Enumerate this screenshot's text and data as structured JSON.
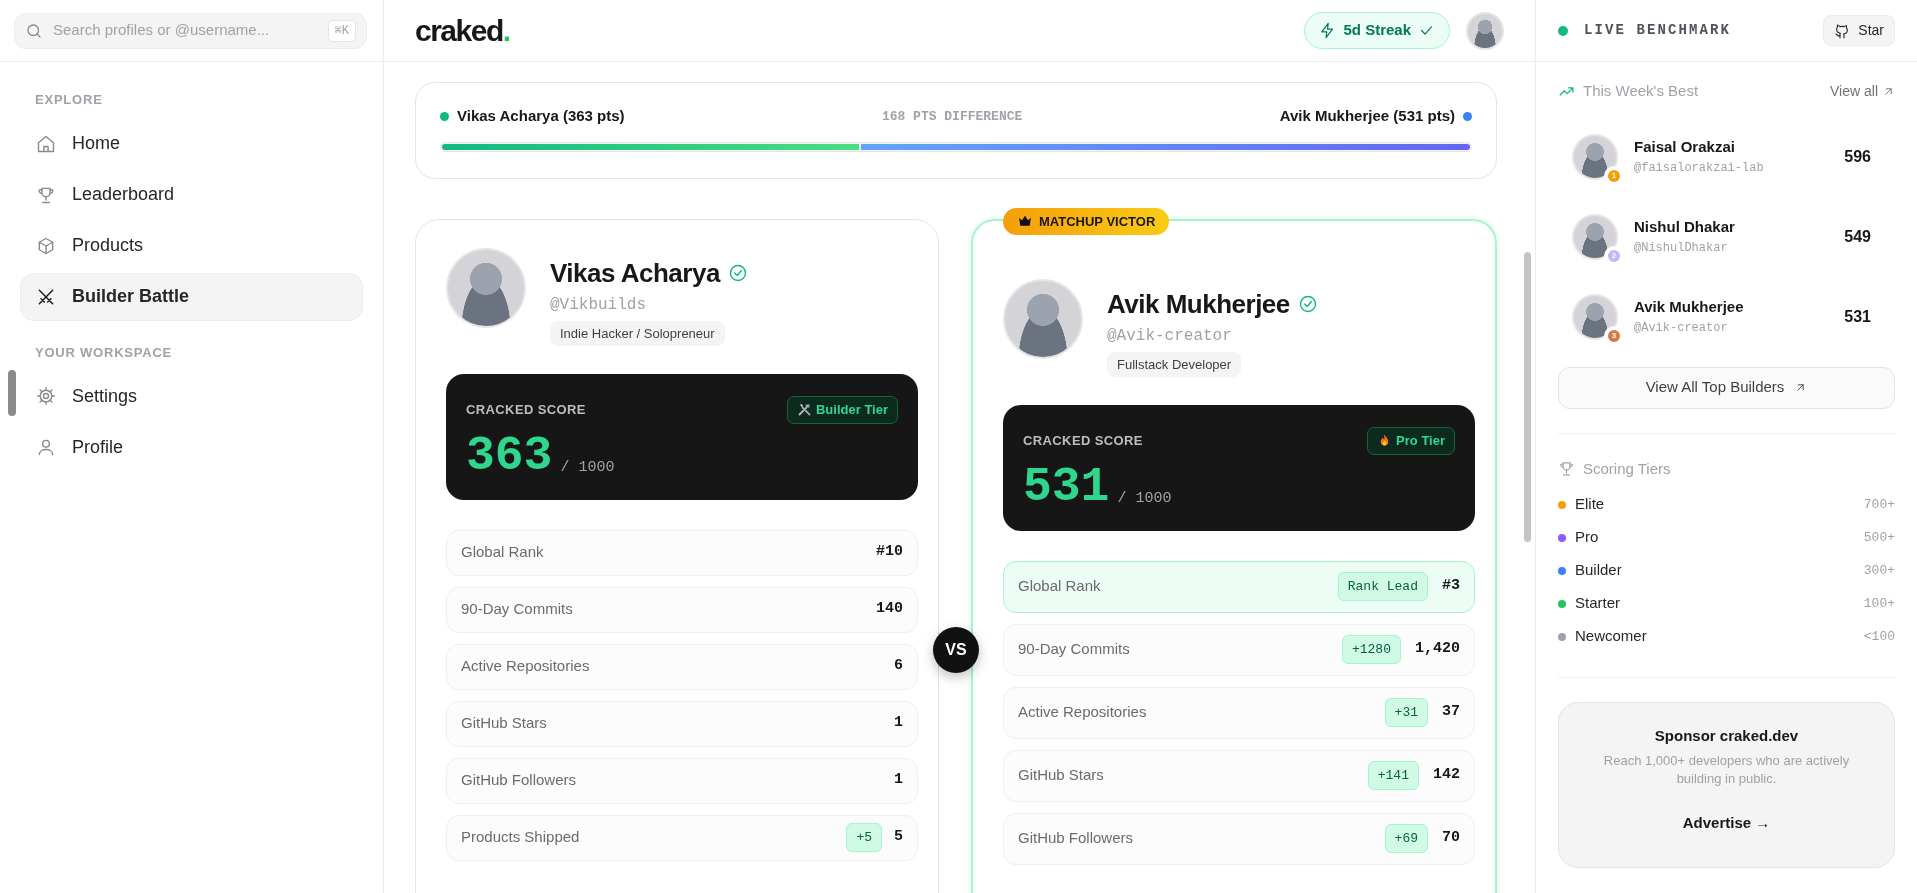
{
  "sidebar": {
    "search": {
      "placeholder": "Search profiles or @username...",
      "shortcut": "⌘K"
    },
    "sections": [
      {
        "title": "EXPLORE",
        "items": [
          {
            "label": "Home",
            "kind": "home",
            "selected": false
          },
          {
            "label": "Leaderboard",
            "kind": "trophy",
            "selected": false
          },
          {
            "label": "Products",
            "kind": "box",
            "selected": false
          },
          {
            "label": "Builder Battle",
            "kind": "swords",
            "selected": true
          }
        ]
      },
      {
        "title": "YOUR WORKSPACE",
        "items": [
          {
            "label": "Settings",
            "kind": "gear",
            "selected": false
          },
          {
            "label": "Profile",
            "kind": "user",
            "selected": false
          }
        ]
      }
    ]
  },
  "header": {
    "logo": {
      "text": "craked",
      "dot": "."
    },
    "streak": "5d Streak"
  },
  "comparison": {
    "left": "Vikas Acharya (363 pts)",
    "difference": "168 PTS DIFFERENCE",
    "right": "Avik Mukherjee (531 pts)",
    "level": 0.406
  },
  "vs": "VS",
  "players": [
    {
      "name": "Vikas Acharya",
      "verified": true,
      "handle": "@Vikbuilds",
      "role": "Indie Hacker / Solopreneur",
      "victor": false,
      "score_label": "CRACKED SCORE",
      "score": "363",
      "max": "/ 1000",
      "tier": {
        "label": "Builder Tier",
        "kind": "tools"
      },
      "stats": [
        {
          "label": "Global Rank",
          "value": "#10",
          "lead": false
        },
        {
          "label": "90-Day Commits",
          "value": "140",
          "lead": false
        },
        {
          "label": "Active Repositories",
          "value": "6",
          "lead": false
        },
        {
          "label": "GitHub Stars",
          "value": "1",
          "lead": false
        },
        {
          "label": "GitHub Followers",
          "value": "1",
          "lead": false
        },
        {
          "label": "Products Shipped",
          "delta": "+5",
          "value": "5",
          "lead": false
        }
      ]
    },
    {
      "name": "Avik Mukherjee",
      "verified": true,
      "handle": "@Avik-creator",
      "role": "Fullstack Developer",
      "victor": true,
      "badge": "MATCHUP VICTOR",
      "score_label": "CRACKED SCORE",
      "score": "531",
      "max": "/ 1000",
      "tier": {
        "label": "Pro Tier",
        "kind": "flame"
      },
      "stats": [
        {
          "label": "Global Rank",
          "delta": "Rank Lead",
          "value": "#3",
          "lead": true
        },
        {
          "label": "90-Day Commits",
          "delta": "+1280",
          "value": "1,420",
          "lead": false
        },
        {
          "label": "Active Repositories",
          "delta": "+31",
          "value": "37",
          "lead": false
        },
        {
          "label": "GitHub Stars",
          "delta": "+141",
          "value": "142",
          "lead": false
        },
        {
          "label": "GitHub Followers",
          "delta": "+69",
          "value": "70",
          "lead": false
        }
      ]
    }
  ],
  "right_panel": {
    "live": "LIVE BENCHMARK",
    "star_button": "Star",
    "weekly": {
      "title": "This Week's Best",
      "view_all": "View all",
      "builders": [
        {
          "name": "Faisal Orakzai",
          "handle": "@faisalorakzai-lab",
          "score": "596",
          "medal": "1",
          "color": "#f59e0b"
        },
        {
          "name": "Nishul Dhakar",
          "handle": "@NishulDhakar",
          "score": "549",
          "medal": "2",
          "color": "#c4b5fd"
        },
        {
          "name": "Avik Mukherjee",
          "handle": "@Avik-creator",
          "score": "531",
          "medal": "3",
          "color": "#d97745"
        }
      ],
      "button": "View All Top Builders"
    },
    "tiers": {
      "title": "Scoring Tiers",
      "items": [
        {
          "name": "Elite",
          "range": "700+",
          "color": "#f59e0b"
        },
        {
          "name": "Pro",
          "range": "500+",
          "color": "#8b5cf6"
        },
        {
          "name": "Builder",
          "range": "300+",
          "color": "#3b82f6"
        },
        {
          "name": "Starter",
          "range": "100+",
          "color": "#22c55e"
        },
        {
          "name": "Newcomer",
          "range": "<100",
          "color": "#9ca3af"
        }
      ]
    },
    "sponsor": {
      "title": "Sponsor craked.dev",
      "text": "Reach 1,000+ developers who are actively building in public.",
      "link": "Advertise →"
    }
  }
}
